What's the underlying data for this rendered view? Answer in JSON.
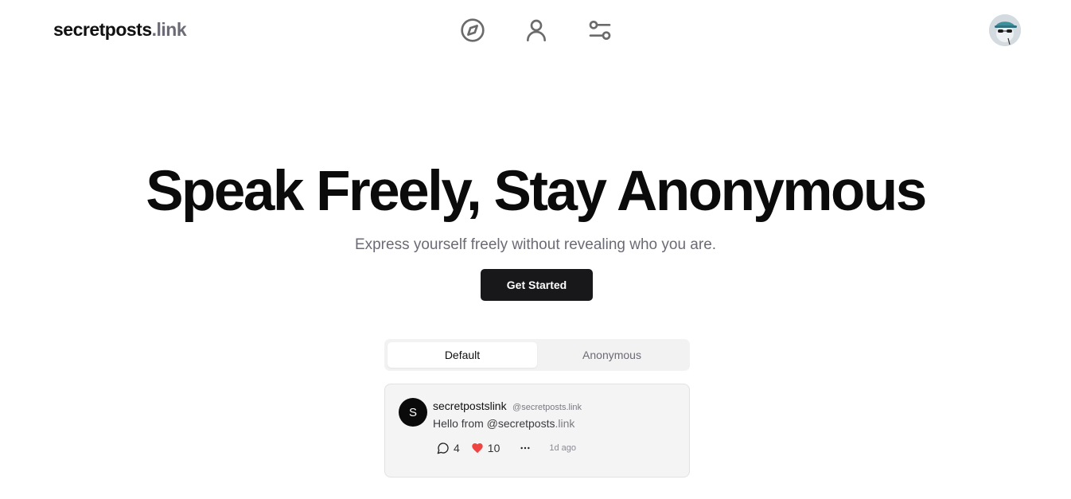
{
  "header": {
    "logo_main": "secretposts",
    "logo_tld": ".link",
    "nav_icons": [
      "compass-icon",
      "user-icon",
      "settings-sliders-icon"
    ],
    "avatar_icon": "profile-avatar"
  },
  "hero": {
    "title": "Speak Freely, Stay Anonymous",
    "subtitle": "Express yourself freely without revealing who you are.",
    "cta_label": "Get Started"
  },
  "tabs": {
    "items": [
      {
        "label": "Default",
        "active": true
      },
      {
        "label": "Anonymous",
        "active": false
      }
    ]
  },
  "post": {
    "avatar_letter": "S",
    "name": "secretpostslink",
    "handle": "@secretposts.link",
    "body_main": "Hello from @secretposts",
    "body_tld": ".link",
    "comments": "4",
    "likes": "10",
    "time": "1d ago"
  },
  "colors": {
    "cta_background": "#18181b",
    "like_heart": "#ef4444",
    "muted_text": "#6b6b75"
  }
}
